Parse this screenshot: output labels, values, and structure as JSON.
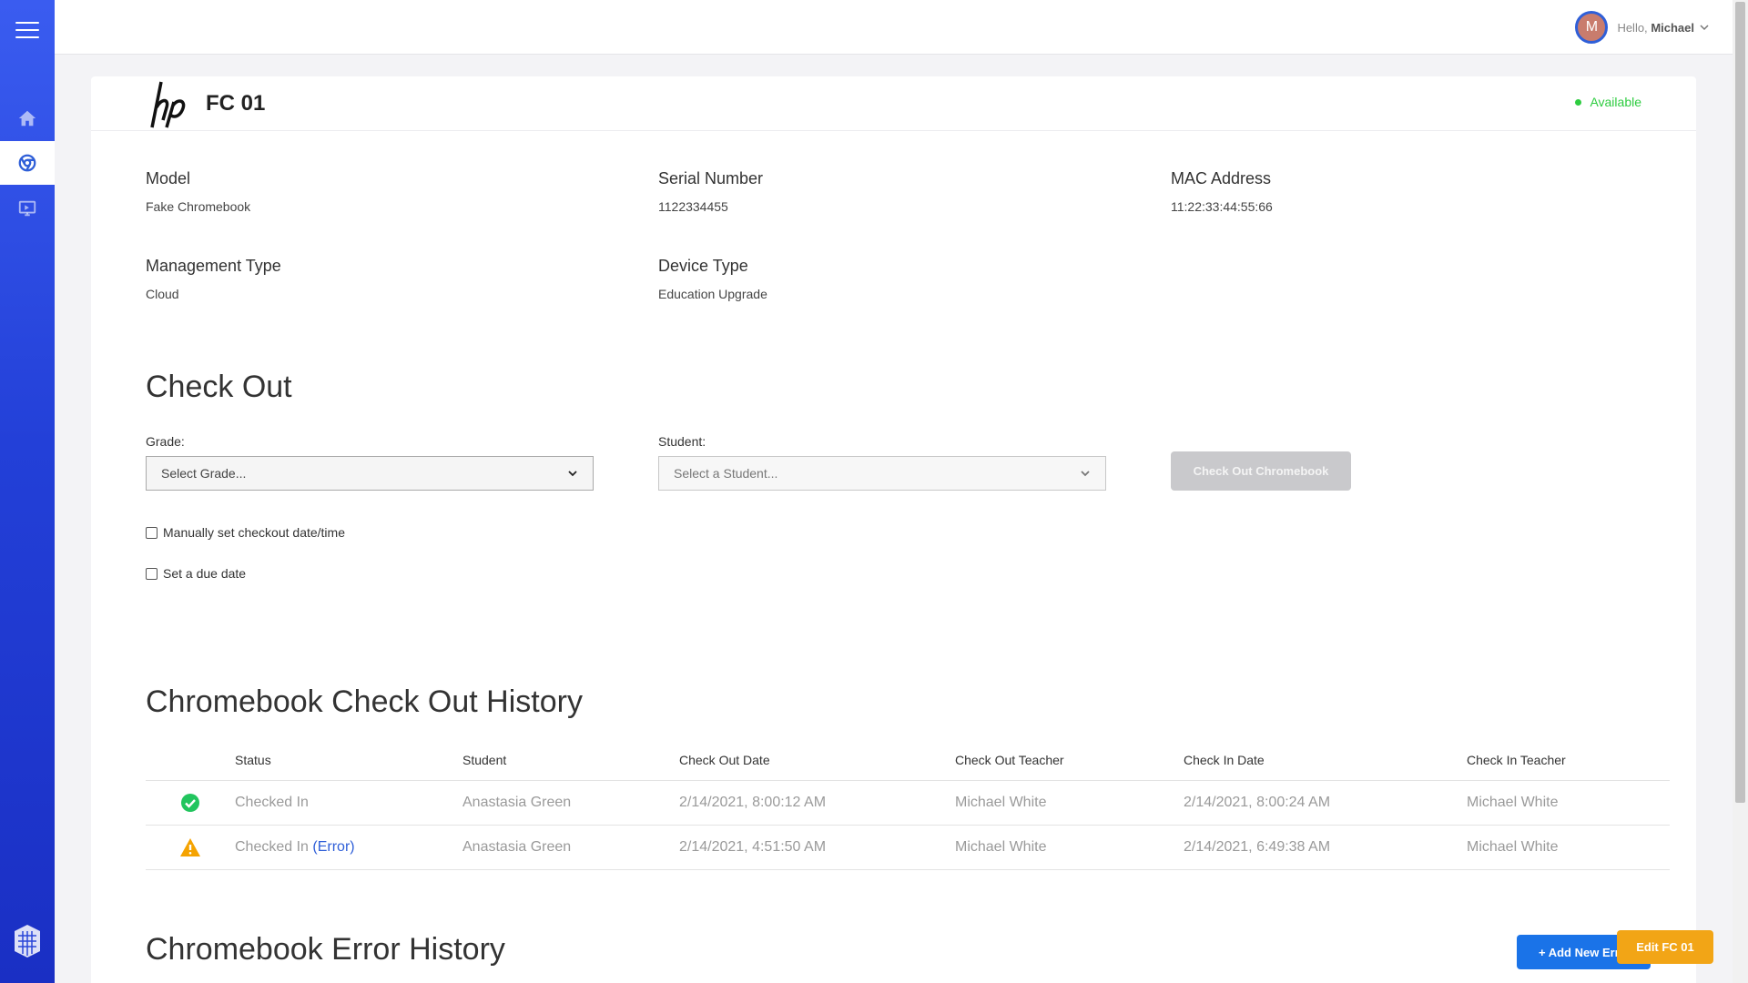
{
  "user": {
    "greeting": "Hello,",
    "name": "Michael",
    "avatar_initial": "M"
  },
  "device": {
    "name": "FC 01",
    "status": "Available"
  },
  "details": {
    "model_label": "Model",
    "model_value": "Fake Chromebook",
    "serial_label": "Serial Number",
    "serial_value": "1122334455",
    "mac_label": "MAC Address",
    "mac_value": "11:22:33:44:55:66",
    "mgmt_label": "Management Type",
    "mgmt_value": "Cloud",
    "type_label": "Device Type",
    "type_value": "Education Upgrade"
  },
  "checkout": {
    "title": "Check Out",
    "grade_label": "Grade:",
    "grade_placeholder": "Select Grade...",
    "student_label": "Student:",
    "student_placeholder": "Select a Student...",
    "button": "Check Out Chromebook",
    "manual_date": "Manually set checkout date/time",
    "due_date": "Set a due date"
  },
  "history": {
    "title": "Chromebook Check Out History",
    "columns": [
      "Status",
      "Student",
      "Check Out Date",
      "Check Out Teacher",
      "Check In Date",
      "Check In Teacher"
    ],
    "rows": [
      {
        "icon": "check-circle-icon",
        "status": "Checked In",
        "error": "",
        "student": "Anastasia Green",
        "checkout_date": "2/14/2021, 8:00:12 AM",
        "checkout_teacher": "Michael White",
        "checkin_date": "2/14/2021, 8:00:24 AM",
        "checkin_teacher": "Michael White"
      },
      {
        "icon": "warning-icon",
        "status": "Checked In",
        "error": "(Error)",
        "student": "Anastasia Green",
        "checkout_date": "2/14/2021, 4:51:50 AM",
        "checkout_teacher": "Michael White",
        "checkin_date": "2/14/2021, 6:49:38 AM",
        "checkin_teacher": "Michael White"
      }
    ]
  },
  "errors": {
    "title": "Chromebook Error History",
    "add_button": "+ Add New Error"
  },
  "edit_button": "Edit FC 01",
  "colors": {
    "sidebar": "#2340d8",
    "available": "#2ecc40",
    "primary": "#1a73e8",
    "edit": "#f2a516",
    "success": "#22c55e",
    "warning": "#f5a300"
  }
}
